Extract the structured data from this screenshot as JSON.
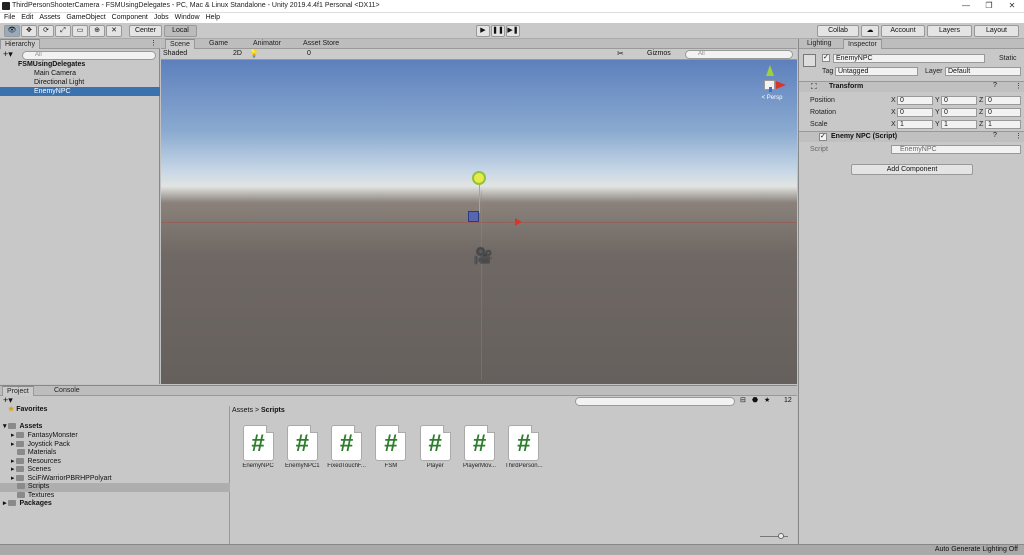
{
  "window": {
    "title": "ThirdPersonShooterCamera - FSMUsingDelegates - PC, Mac & Linux Standalone - Unity 2019.4.4f1 Personal <DX11>"
  },
  "menu": [
    "File",
    "Edit",
    "Assets",
    "GameObject",
    "Component",
    "Jobs",
    "Window",
    "Help"
  ],
  "toolbar": {
    "pivot": "Center",
    "space": "Local",
    "collab": "Collab",
    "account": "Account",
    "layers": "Layers",
    "layout": "Layout"
  },
  "hierarchy": {
    "tab": "Hierarchy",
    "search_placeholder": "All",
    "scene": "FSMUsingDelegates",
    "items": [
      "Main Camera",
      "Directional Light",
      "EnemyNPC"
    ]
  },
  "scene": {
    "tabs": [
      "Scene",
      "Game",
      "Animator",
      "Asset Store"
    ],
    "shading": "Shaded",
    "mode": "2D",
    "hidden_count": "0",
    "gizmos": "Gizmos",
    "search_placeholder": "All",
    "persp_label": "< Persp"
  },
  "inspector": {
    "tabs": [
      "Lighting",
      "Inspector"
    ],
    "object_name": "EnemyNPC",
    "static_label": "Static",
    "tag_label": "Tag",
    "tag_value": "Untagged",
    "layer_label": "Layer",
    "layer_value": "Default",
    "transform": {
      "title": "Transform",
      "rows": [
        {
          "label": "Position",
          "x": "0",
          "y": "0",
          "z": "0"
        },
        {
          "label": "Rotation",
          "x": "0",
          "y": "0",
          "z": "0"
        },
        {
          "label": "Scale",
          "x": "1",
          "y": "1",
          "z": "1"
        }
      ]
    },
    "script_component": {
      "title": "Enemy NPC (Script)",
      "label": "Script",
      "value": "EnemyNPC"
    },
    "add_component": "Add Component"
  },
  "project": {
    "tabs": [
      "Project",
      "Console"
    ],
    "favorites": "Favorites",
    "assets_root": "Assets",
    "folders": [
      "FantasyMonster",
      "Joystick Pack",
      "Materials",
      "Resources",
      "Scenes",
      "SciFiWarriorPBRHPPolyart",
      "Scripts",
      "Textures"
    ],
    "packages": "Packages",
    "breadcrumb": [
      "Assets",
      "Scripts"
    ],
    "count": "12",
    "files": [
      "EnemyNPC",
      "EnemyNPC1",
      "FixedTouchF...",
      "FSM",
      "Player",
      "PlayerMov...",
      "ThirdPerson..."
    ]
  },
  "status": {
    "right": "Auto Generate Lighting Off"
  },
  "colors": {
    "selection": "#3a72b0",
    "script_icon": "#2d7d2d",
    "axis_x": "#d9362b",
    "axis_y": "#9bd13d",
    "axis_z": "#3c6fd6"
  }
}
